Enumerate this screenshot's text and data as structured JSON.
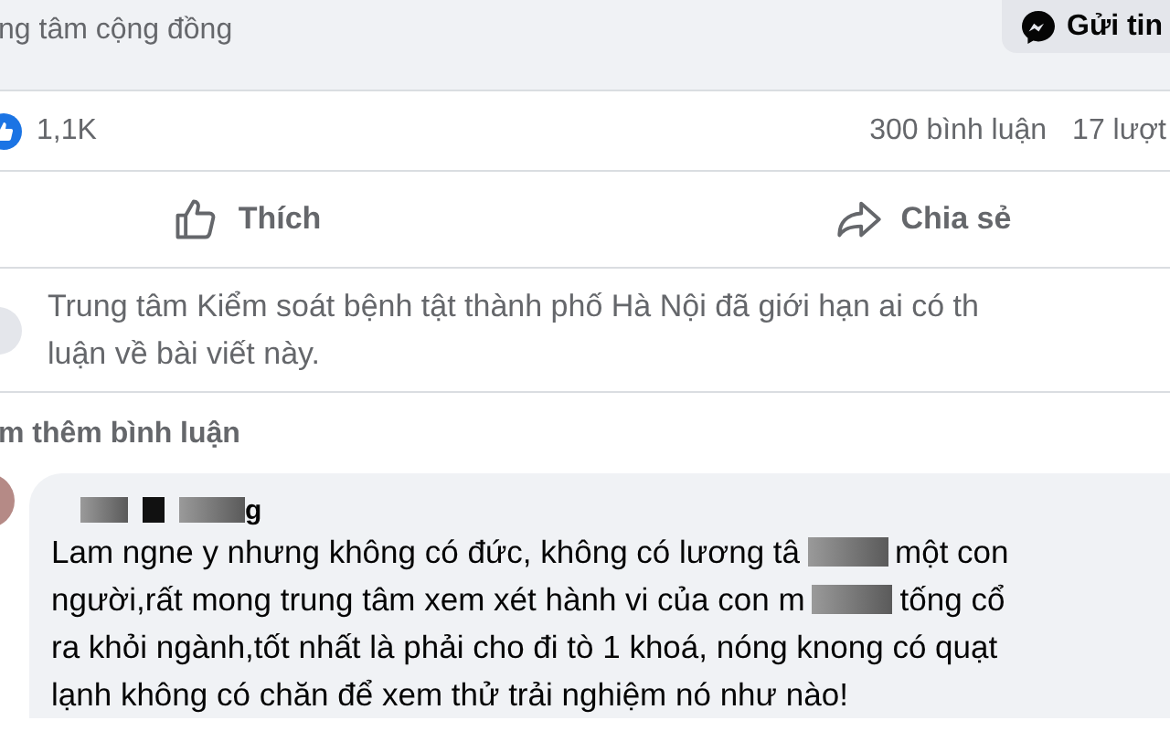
{
  "header": {
    "subtitle": "ng tâm cộng đồng",
    "message_button": "Gửi tin"
  },
  "stats": {
    "reactions": "1,1K",
    "comments": "300 bình luận",
    "shares": "17 lượt"
  },
  "actions": [
    {
      "kind": "like",
      "label": "Thích"
    },
    {
      "kind": "share",
      "label": "Chia sẻ"
    }
  ],
  "notice": {
    "lines": [
      "Trung tâm Kiểm soát bệnh tật thành phố Hà Nội đã giới hạn ai có th",
      "luận về bài viết này."
    ]
  },
  "more_comments": "m thêm bình luận",
  "comment": {
    "author": "g",
    "lines": [
      [
        {
          "kind": "text",
          "text": "Lam ngne y nhưng không có đức, không có lương tâ"
        },
        {
          "kind": "censor"
        },
        {
          "kind": "text",
          "text": "một con"
        }
      ],
      [
        {
          "kind": "text",
          "text": "người,rất mong trung tâm xem xét hành vi của con m"
        },
        {
          "kind": "censor"
        },
        {
          "kind": "text",
          "text": "tống cổ"
        }
      ],
      [
        {
          "kind": "text",
          "text": "ra khỏi ngành,tốt nhất là phải cho đi tò 1 khoá, nóng knong có quạt"
        }
      ],
      [
        {
          "kind": "text",
          "text": "lạnh không có chăn để xem thử trải nghiệm nó như nào!"
        }
      ]
    ]
  }
}
